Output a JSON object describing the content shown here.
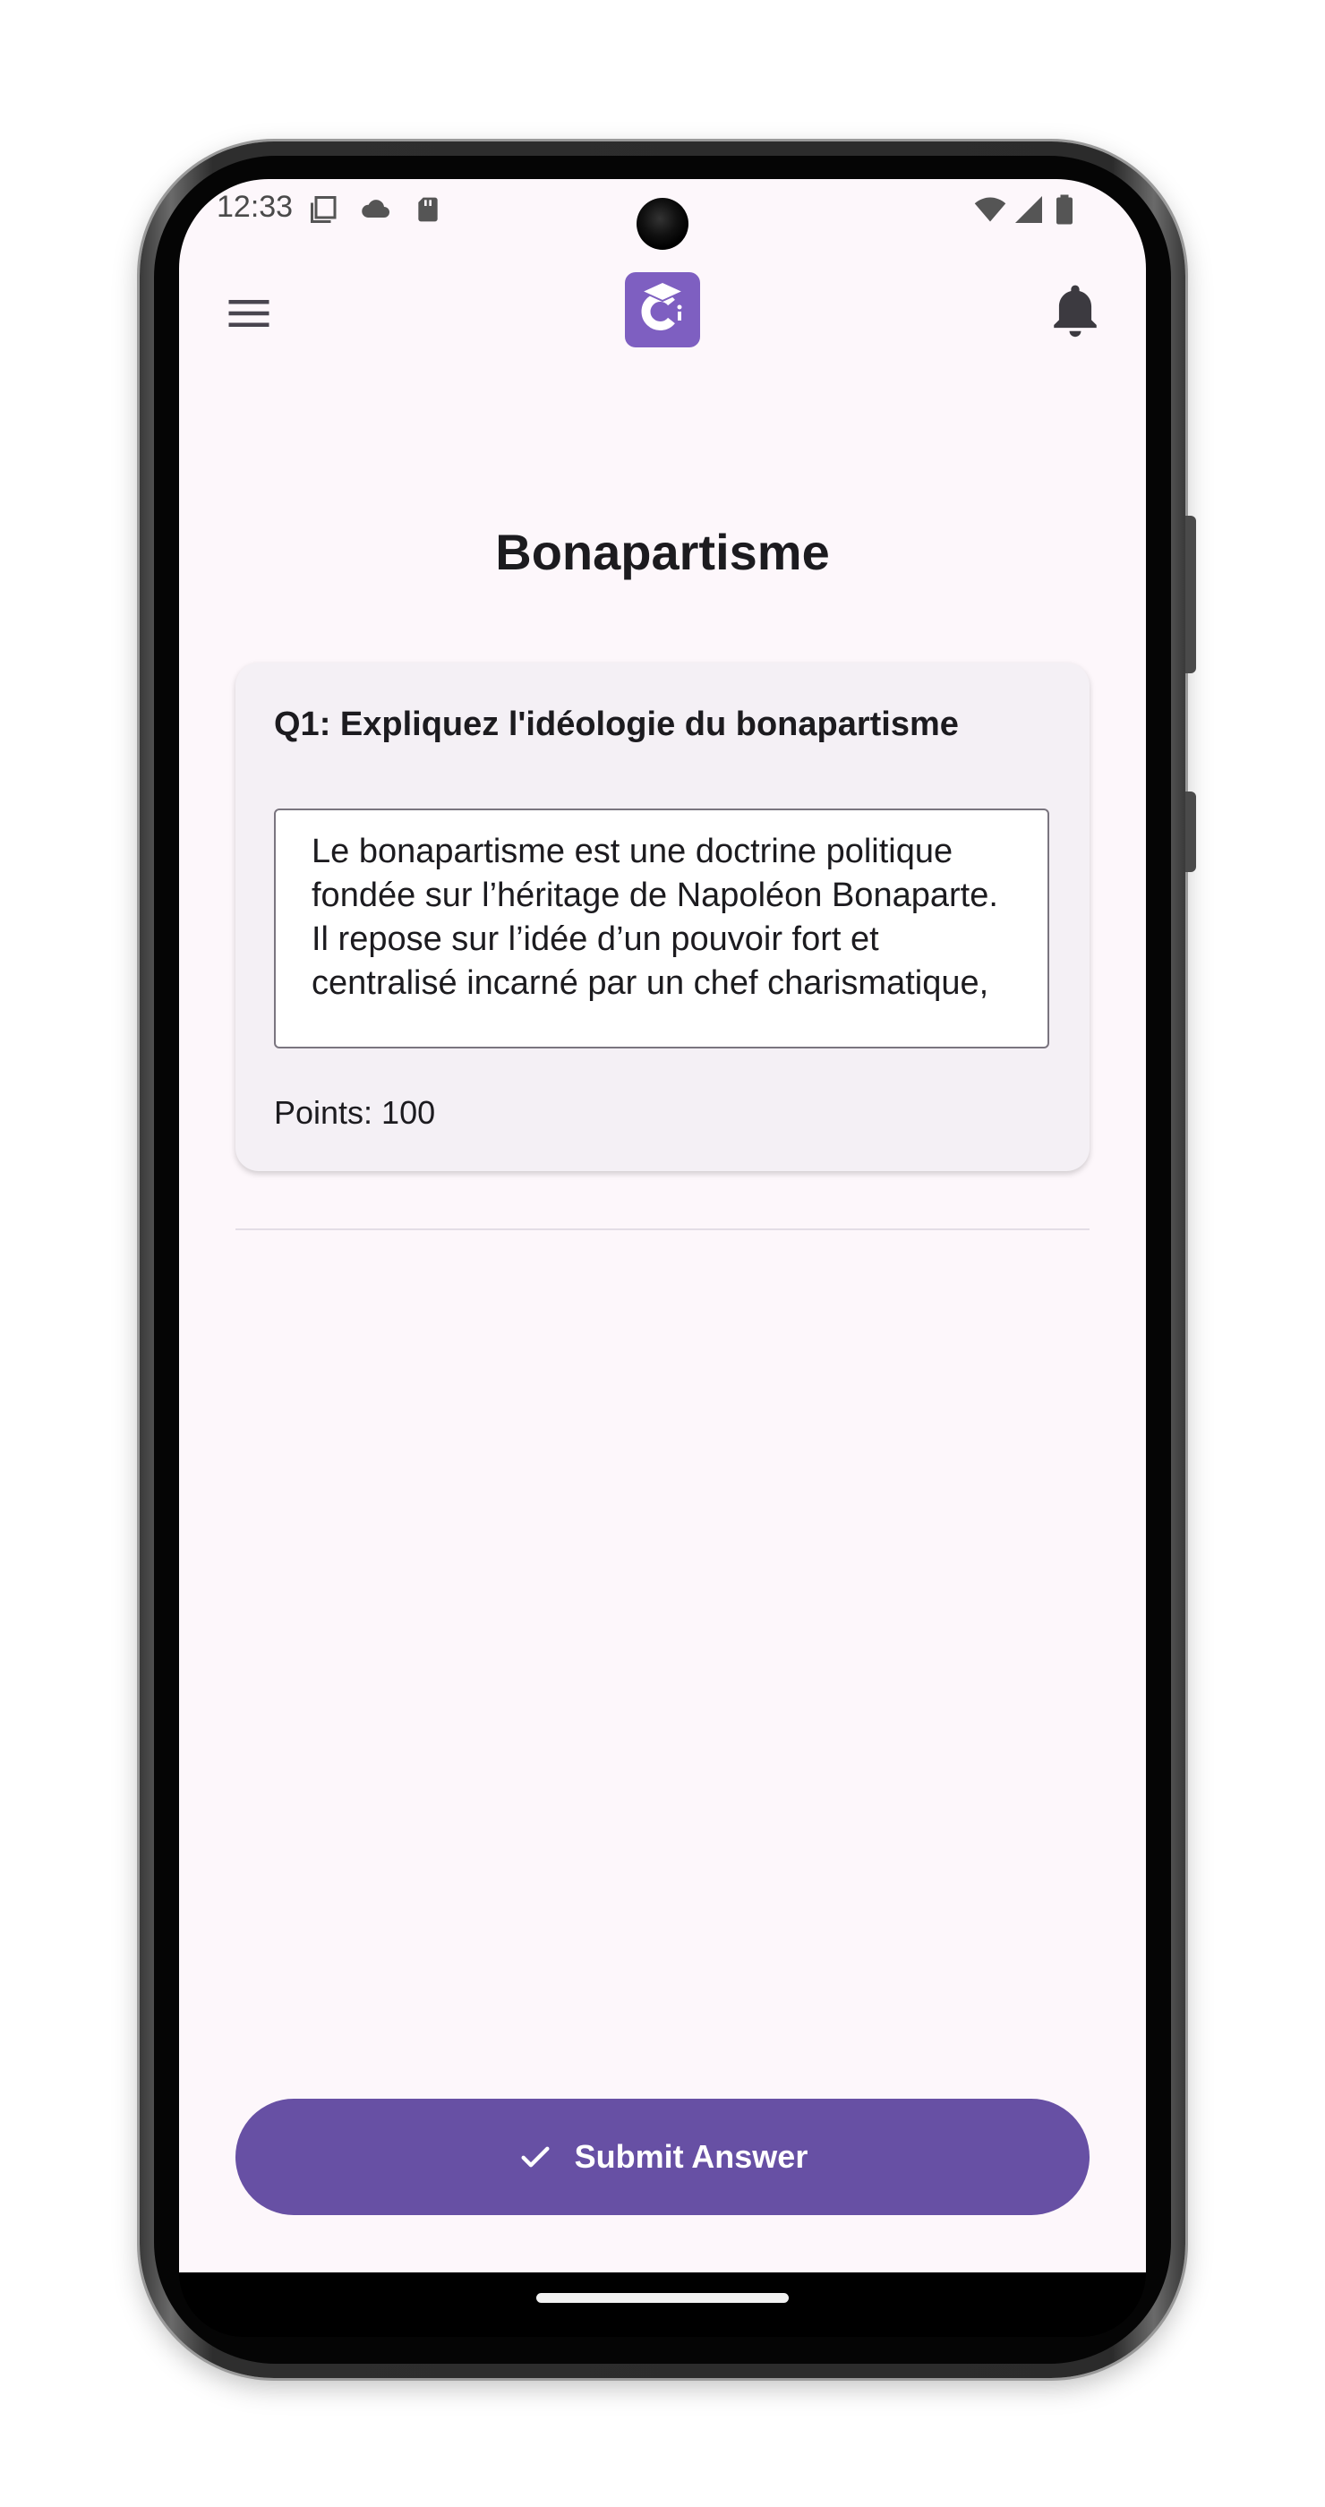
{
  "status_bar": {
    "time": "12:33",
    "icons": [
      "screen-icon",
      "cloud-icon",
      "sd-card-icon",
      "wifi-icon",
      "signal-icon",
      "battery-icon"
    ]
  },
  "app_bar": {
    "menu_icon": "hamburger-menu-icon",
    "logo_icon": "graduation-cap-c-logo",
    "notification_icon": "bell-icon",
    "accent_color": "#7e5fc1"
  },
  "page": {
    "title": "Bonapartisme"
  },
  "question_card": {
    "question": "Q1: Expliquez l'idéologie du bonapartisme",
    "answer": "Le bonapartisme est une doctrine politique fondée sur l’héritage de Napoléon Bonaparte. Il repose sur l’idée d’un pouvoir fort et centralisé incarné par un chef charismatique,",
    "points": "Points: 100"
  },
  "submit": {
    "label": "Submit Answer",
    "icon": "check-icon",
    "color": "#6750a4"
  }
}
